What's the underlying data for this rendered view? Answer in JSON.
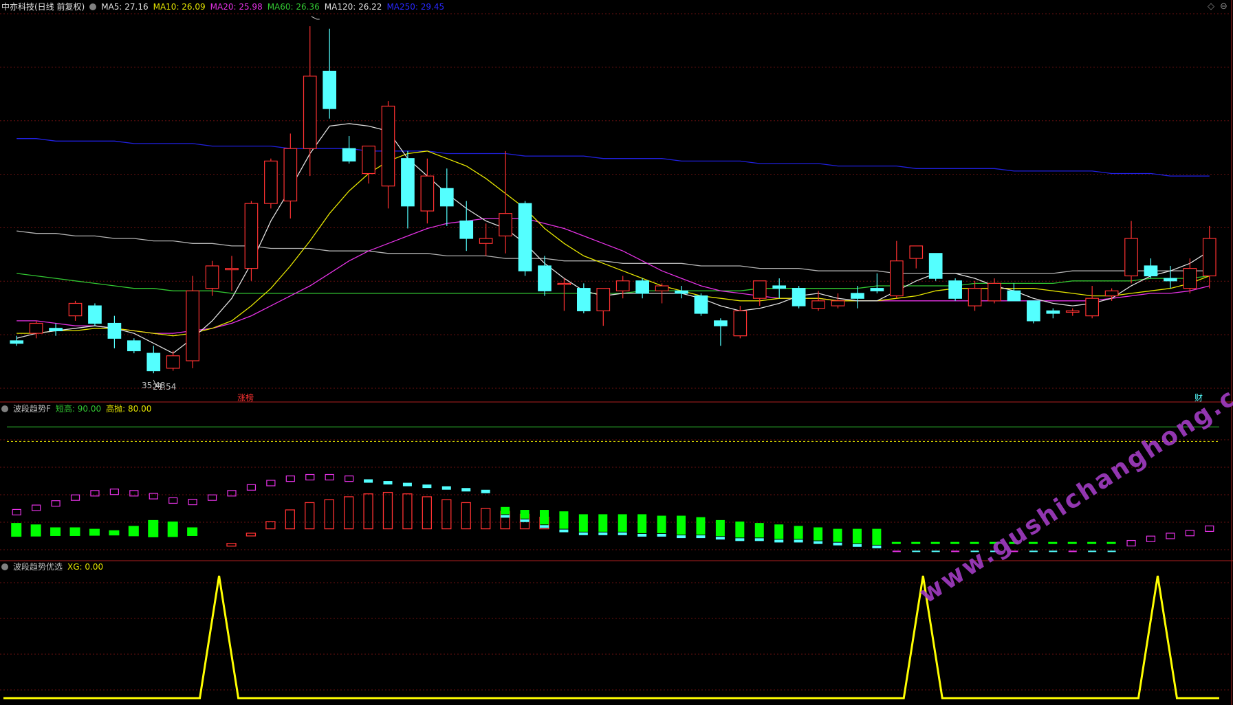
{
  "main_header": {
    "title": "中亦科技(日线 前复权)",
    "ma5": "MA5: 27.16",
    "ma10": "MA10: 26.09",
    "ma20": "MA20: 25.98",
    "ma60": "MA60: 26.36",
    "ma120": "MA120: 26.22",
    "ma250": "MA250: 29.45"
  },
  "markers": {
    "high": "35.48",
    "low": "21.54",
    "tag_limit": "涨榜",
    "tag_fin": "财"
  },
  "ind1_header": {
    "name": "波段趋势F",
    "short_high": "短高: 90.00",
    "high_sell": "高抛: 80.00"
  },
  "ind2_header": {
    "name": "波段趋势优选",
    "xg": "XG: 0.00"
  },
  "watermark": "www.gushichanghong.com",
  "colors": {
    "up": "#ff3232",
    "down": "#54ffff",
    "ma5": "#e0e0e0",
    "ma10": "#e6e600",
    "ma20": "#e632e6",
    "ma60": "#32c832",
    "ma120": "#b4b4b4",
    "ma250": "#2020e0",
    "xg": "#ffff00"
  },
  "chart_data": {
    "type": "candlestick",
    "y_range": [
      21.0,
      36.0
    ],
    "candles": [
      [
        22.9,
        23.1,
        22.7,
        22.8
      ],
      [
        23.2,
        23.7,
        23.0,
        23.6
      ],
      [
        23.4,
        23.6,
        23.1,
        23.3
      ],
      [
        23.9,
        24.5,
        23.7,
        24.4
      ],
      [
        24.3,
        24.4,
        23.5,
        23.6
      ],
      [
        23.6,
        23.9,
        22.6,
        23.0
      ],
      [
        22.9,
        23.0,
        22.4,
        22.5
      ],
      [
        22.4,
        22.7,
        21.6,
        21.7
      ],
      [
        21.8,
        22.5,
        21.7,
        22.3
      ],
      [
        22.1,
        25.5,
        21.8,
        24.9
      ],
      [
        25.0,
        26.1,
        24.7,
        25.9
      ],
      [
        25.8,
        26.3,
        24.9,
        25.8
      ],
      [
        25.8,
        28.5,
        25.3,
        28.4
      ],
      [
        28.4,
        30.2,
        28.2,
        30.1
      ],
      [
        28.5,
        31.2,
        27.8,
        30.6
      ],
      [
        30.6,
        35.5,
        29.5,
        33.5
      ],
      [
        33.7,
        35.4,
        31.8,
        32.2
      ],
      [
        30.6,
        31.1,
        30.0,
        30.1
      ],
      [
        29.6,
        30.7,
        29.2,
        30.7
      ],
      [
        29.1,
        32.5,
        28.2,
        32.3
      ],
      [
        30.2,
        30.5,
        27.4,
        28.3
      ],
      [
        28.1,
        30.2,
        27.6,
        29.5
      ],
      [
        29.0,
        29.8,
        27.5,
        28.3
      ],
      [
        27.7,
        28.5,
        26.5,
        27.0
      ],
      [
        26.8,
        27.6,
        26.3,
        27.0
      ],
      [
        27.1,
        30.5,
        26.4,
        28.0
      ],
      [
        28.4,
        28.5,
        25.5,
        25.7
      ],
      [
        25.9,
        26.3,
        24.7,
        24.9
      ],
      [
        25.2,
        25.4,
        24.1,
        25.2
      ],
      [
        25.0,
        25.2,
        24.0,
        24.1
      ],
      [
        24.1,
        25.0,
        23.5,
        25.0
      ],
      [
        24.9,
        25.5,
        24.6,
        25.3
      ],
      [
        25.3,
        25.4,
        24.6,
        24.8
      ],
      [
        24.9,
        25.2,
        24.4,
        25.1
      ],
      [
        24.9,
        25.1,
        24.6,
        24.8
      ],
      [
        24.7,
        24.8,
        23.9,
        24.0
      ],
      [
        23.7,
        23.8,
        22.7,
        23.5
      ],
      [
        23.1,
        24.3,
        23.0,
        24.1
      ],
      [
        24.6,
        25.3,
        24.3,
        25.3
      ],
      [
        25.1,
        25.4,
        24.6,
        25.0
      ],
      [
        25.0,
        25.1,
        24.2,
        24.3
      ],
      [
        24.2,
        24.9,
        24.1,
        24.5
      ],
      [
        24.3,
        24.8,
        24.2,
        24.5
      ],
      [
        24.8,
        25.1,
        24.2,
        24.6
      ],
      [
        25.0,
        25.6,
        24.8,
        24.9
      ],
      [
        24.7,
        26.9,
        24.6,
        26.1
      ],
      [
        26.2,
        26.7,
        25.8,
        26.7
      ],
      [
        26.4,
        26.4,
        25.3,
        25.4
      ],
      [
        25.3,
        25.4,
        24.5,
        24.6
      ],
      [
        24.3,
        25.3,
        24.1,
        25.0
      ],
      [
        24.5,
        25.4,
        24.4,
        25.2
      ],
      [
        24.9,
        25.2,
        24.5,
        24.5
      ],
      [
        24.5,
        24.5,
        23.6,
        23.7
      ],
      [
        24.1,
        24.2,
        23.8,
        24.0
      ],
      [
        24.1,
        24.2,
        23.9,
        24.1
      ],
      [
        23.9,
        25.1,
        23.8,
        24.6
      ],
      [
        24.7,
        25.0,
        24.5,
        24.9
      ],
      [
        25.5,
        27.7,
        25.2,
        27.0
      ],
      [
        25.9,
        26.2,
        25.4,
        25.5
      ],
      [
        25.4,
        25.9,
        25.0,
        25.3
      ],
      [
        25.0,
        26.2,
        24.8,
        25.8
      ],
      [
        25.5,
        27.5,
        25.0,
        27.0
      ]
    ],
    "ma": {
      "ma5": [
        23.0,
        23.2,
        23.3,
        23.4,
        23.5,
        23.4,
        23.2,
        22.8,
        22.4,
        23.0,
        23.7,
        24.6,
        26.0,
        27.7,
        29.0,
        30.4,
        31.5,
        31.6,
        31.5,
        31.3,
        30.2,
        29.5,
        28.8,
        28.2,
        27.7,
        27.4,
        26.8,
        26.0,
        25.4,
        24.9,
        24.7,
        24.8,
        24.8,
        24.8,
        24.8,
        24.6,
        24.3,
        24.1,
        24.2,
        24.4,
        24.7,
        24.8,
        24.6,
        24.5,
        24.5,
        24.9,
        25.3,
        25.6,
        25.6,
        25.4,
        25.1,
        24.9,
        24.6,
        24.4,
        24.3,
        24.4,
        24.6,
        25.1,
        25.5,
        25.7,
        26.0,
        26.5
      ],
      "ma10": [
        23.2,
        23.2,
        23.3,
        23.3,
        23.4,
        23.4,
        23.3,
        23.2,
        23.1,
        23.2,
        23.4,
        23.7,
        24.3,
        25.0,
        25.9,
        26.9,
        28.0,
        28.9,
        29.6,
        30.1,
        30.4,
        30.5,
        30.2,
        29.9,
        29.4,
        28.8,
        28.2,
        27.4,
        26.8,
        26.3,
        26.0,
        25.7,
        25.4,
        25.1,
        24.9,
        24.7,
        24.6,
        24.5,
        24.5,
        24.6,
        24.6,
        24.6,
        24.5,
        24.5,
        24.5,
        24.6,
        24.7,
        24.9,
        25.0,
        25.0,
        25.0,
        25.0,
        25.0,
        24.9,
        24.8,
        24.7,
        24.7,
        24.8,
        24.9,
        25.0,
        25.2,
        25.5
      ],
      "ma20": [
        23.7,
        23.7,
        23.6,
        23.5,
        23.5,
        23.4,
        23.3,
        23.2,
        23.2,
        23.3,
        23.4,
        23.6,
        23.9,
        24.3,
        24.7,
        25.1,
        25.6,
        26.1,
        26.5,
        26.8,
        27.1,
        27.4,
        27.6,
        27.7,
        27.8,
        27.8,
        27.8,
        27.6,
        27.4,
        27.1,
        26.8,
        26.5,
        26.1,
        25.7,
        25.4,
        25.1,
        24.9,
        24.8,
        24.7,
        24.6,
        24.6,
        24.6,
        24.5,
        24.5,
        24.5,
        24.5,
        24.5,
        24.5,
        24.5,
        24.5,
        24.5,
        24.5,
        24.5,
        24.5,
        24.5,
        24.5,
        24.6,
        24.7,
        24.8,
        24.8,
        24.9,
        25.1
      ],
      "ma60": [
        25.6,
        25.5,
        25.4,
        25.3,
        25.2,
        25.1,
        25.0,
        25.0,
        24.9,
        24.9,
        24.9,
        24.8,
        24.8,
        24.8,
        24.8,
        24.8,
        24.8,
        24.8,
        24.8,
        24.8,
        24.8,
        24.8,
        24.8,
        24.8,
        24.8,
        24.8,
        24.8,
        24.8,
        24.8,
        24.8,
        24.8,
        24.8,
        24.9,
        24.9,
        24.9,
        24.9,
        24.9,
        24.9,
        25.0,
        25.0,
        25.0,
        25.0,
        25.0,
        25.0,
        25.1,
        25.1,
        25.1,
        25.1,
        25.1,
        25.2,
        25.2,
        25.2,
        25.2,
        25.2,
        25.3,
        25.3,
        25.3,
        25.3,
        25.4,
        25.4,
        25.4,
        25.5
      ],
      "ma120": [
        27.3,
        27.2,
        27.2,
        27.1,
        27.1,
        27.0,
        27.0,
        26.9,
        26.9,
        26.8,
        26.8,
        26.7,
        26.7,
        26.6,
        26.6,
        26.6,
        26.5,
        26.5,
        26.5,
        26.4,
        26.4,
        26.4,
        26.3,
        26.3,
        26.3,
        26.2,
        26.2,
        26.2,
        26.1,
        26.1,
        26.1,
        26.0,
        26.0,
        26.0,
        26.0,
        25.9,
        25.9,
        25.9,
        25.8,
        25.8,
        25.8,
        25.7,
        25.7,
        25.7,
        25.7,
        25.6,
        25.6,
        25.6,
        25.6,
        25.6,
        25.6,
        25.6,
        25.6,
        25.6,
        25.7,
        25.7,
        25.7,
        25.7,
        25.7,
        25.7,
        25.7,
        25.7
      ],
      "ma250": [
        31.0,
        31.0,
        30.9,
        30.9,
        30.9,
        30.9,
        30.8,
        30.8,
        30.8,
        30.8,
        30.7,
        30.7,
        30.7,
        30.7,
        30.6,
        30.6,
        30.6,
        30.6,
        30.5,
        30.5,
        30.5,
        30.5,
        30.4,
        30.4,
        30.4,
        30.4,
        30.3,
        30.3,
        30.3,
        30.3,
        30.2,
        30.2,
        30.2,
        30.2,
        30.1,
        30.1,
        30.1,
        30.1,
        30.0,
        30.0,
        30.0,
        30.0,
        29.9,
        29.9,
        29.9,
        29.9,
        29.8,
        29.8,
        29.8,
        29.8,
        29.8,
        29.7,
        29.7,
        29.7,
        29.7,
        29.7,
        29.6,
        29.6,
        29.6,
        29.5,
        29.5,
        29.5
      ]
    },
    "indicator1": {
      "levels": {
        "short_high": 90,
        "high_sell": 80
      },
      "y_range": [
        0,
        100
      ],
      "pink": [
        30,
        33,
        36,
        40,
        43,
        44,
        43,
        41,
        38,
        37,
        40,
        43,
        47,
        50,
        53,
        54,
        54,
        53
      ],
      "cyan_top": [
        51,
        50,
        49,
        48,
        47,
        46,
        45,
        44,
        43,
        42,
        41,
        40,
        39,
        38,
        37,
        36,
        35,
        34
      ],
      "red": [
        10,
        17,
        25,
        33,
        38,
        40,
        42,
        44,
        45,
        44,
        42,
        40,
        38,
        34,
        32,
        30,
        28
      ]
    },
    "indicator2": {
      "y_range": [
        0,
        100
      ],
      "xg_spikes": [
        10,
        46,
        58
      ]
    }
  }
}
